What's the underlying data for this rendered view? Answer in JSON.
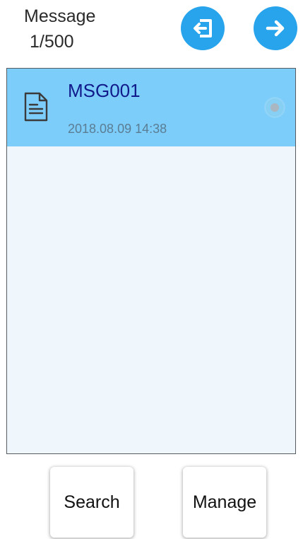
{
  "header": {
    "title": "Message",
    "count": "1/500",
    "exit_icon": "exit-icon",
    "next_icon": "arrow-right-icon"
  },
  "list": {
    "items": [
      {
        "title": "MSG001",
        "timestamp": "2018.08.09 14:38",
        "icon": "document-icon",
        "selected": true
      }
    ]
  },
  "footer": {
    "search_label": "Search",
    "manage_label": "Manage"
  },
  "colors": {
    "accent": "#27a4ec",
    "selected_row": "#7ccdfa",
    "list_background": "#eff6fc",
    "title_text": "#111a8a",
    "timestamp_text": "#5b7d93"
  }
}
